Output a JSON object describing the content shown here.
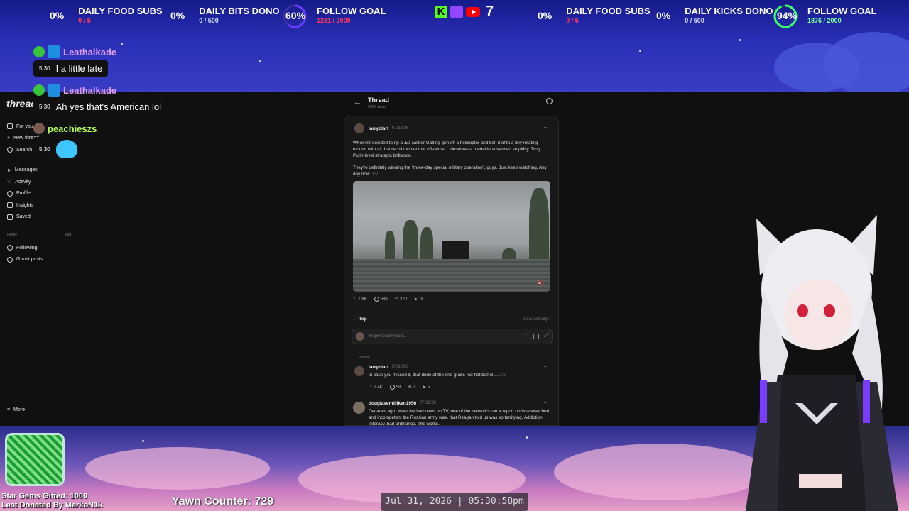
{
  "top_goals_left": [
    {
      "pct": "0%",
      "title": "DAILY FOOD SUBS",
      "sub": "0 / 5",
      "sub_color": "red"
    },
    {
      "pct": "0%",
      "title": "DAILY BITS DONO",
      "sub": "0 / 500",
      "sub_color": "light"
    },
    {
      "pct": "60%",
      "title": "FOLLOW GOAL",
      "sub": "1281 / 2000",
      "sub_color": "red",
      "progress": 0.6
    }
  ],
  "platform_count": "7",
  "top_goals_right": [
    {
      "pct": "0%",
      "title": "DAILY FOOD SUBS",
      "sub": "0 / 5",
      "sub_color": "red"
    },
    {
      "pct": "0%",
      "title": "DAILY KICKS DONO",
      "sub": "0 / 500",
      "sub_color": "light"
    },
    {
      "pct": "94%",
      "title": "FOLLOW GOAL",
      "sub": "1876 / 2000",
      "sub_color": "green",
      "progress": 0.94
    }
  ],
  "chat": [
    {
      "user": "Leathalkade",
      "time": "5:30",
      "msg": "I a little late"
    },
    {
      "user": "Leathalkade",
      "time": "5:30",
      "msg": "Ah yes that's American lol"
    },
    {
      "user": "peachieszs",
      "time": "5:30",
      "msg": ""
    }
  ],
  "threads_app": {
    "logo": "threads",
    "nav": [
      "For you",
      "New thread",
      "Search",
      "Messages",
      "Activity",
      "Profile",
      "Insights",
      "Saved"
    ],
    "feeds_label": "Feeds",
    "edit_label": "Edit",
    "feeds": [
      "Following",
      "Ghost posts"
    ],
    "more": "More",
    "header_title": "Thread",
    "header_views": "382K views"
  },
  "post": {
    "user": "larryolart",
    "date": "07/13/26",
    "text1": "Whoever decided to rip a .50-caliber Gatling gun off a helicopter and bolt it onto a tiny rotating mount, with all that recoil momentum off-center... deserves a medal in advanced stupidity. Truly Putin-level strategic brilliance.",
    "text2": "They're definitely winning the \"three-day special military operation\", guys. Just keep watching. Any day now.",
    "page": "1/2",
    "likes": "7.8K",
    "comments": "688",
    "reposts": "370",
    "shares": "1K"
  },
  "sort_label": "Top",
  "view_activity": "View activity",
  "reply_placeholder": "Reply to larryolart...",
  "pinned_label": "Pinned",
  "reply1": {
    "user": "larryolart",
    "date": "07/13/26",
    "text": "In case you missed it, that dude at the end grabs red-hot barrel ...",
    "page": "2/2",
    "likes": "2.4K",
    "comments": "58",
    "reposts": "7",
    "shares": "5"
  },
  "reply2": {
    "user": "douglasemilliken1956",
    "date": "07/13/26",
    "text": "Decades ago, when we had news on TV, one of the networks ran a report on how wretched and incompetent the Russian army was, that Reagan told us was so terrifying. Addiction, illiteracy, bad ordinance. The works."
  },
  "star_gems": "Star Gems Gifted: 1000",
  "last_donated": "Last Donated By MarkoN1k",
  "yawn": "Yawn Counter: 729",
  "clock": "Jul 31, 2026 | 05:30:58pm"
}
